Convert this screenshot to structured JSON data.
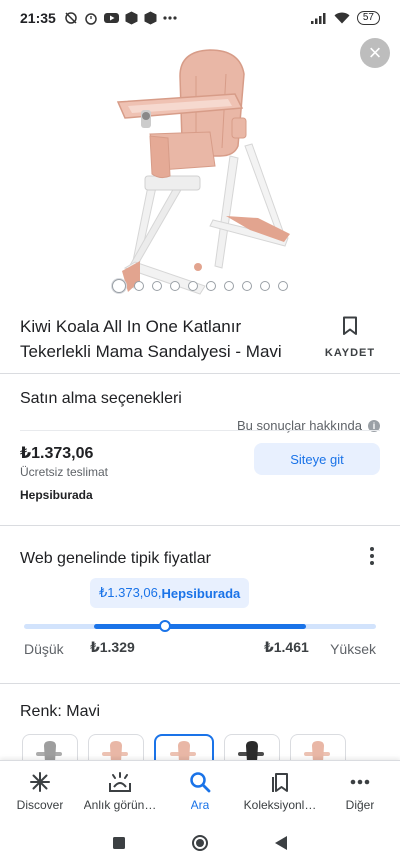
{
  "status_bar": {
    "time": "21:35",
    "battery": "57",
    "icons": [
      "alarm-off-icon",
      "alarm-icon",
      "youtube-icon",
      "package-icon",
      "package-icon",
      "more-dots-icon",
      "signal-icon",
      "wifi-icon",
      "battery-icon"
    ]
  },
  "hero": {
    "image_alt": "pink high chair",
    "image_count": 10,
    "active_index": 0,
    "close_icon": "close-icon"
  },
  "product": {
    "title": "Kiwi Koala All In One Katlanır Tekerlekli Mama Sandalyesi - Mavi",
    "save_label": "KAYDET"
  },
  "buying": {
    "heading": "Satın alma seçenekleri",
    "about_results": "Bu sonuçlar hakkında",
    "price": "₺1.373,06",
    "shipping": "Ücretsiz teslimat",
    "seller": "Hepsiburada",
    "visit_button": "Siteye git"
  },
  "price_range": {
    "heading": "Web genelinde tipik fiyatlar",
    "tooltip_price": "₺1.373,06, ",
    "tooltip_seller": "Hepsiburada",
    "low_label": "Düşük",
    "high_label": "Yüksek",
    "low_value": "₺1.329",
    "high_value": "₺1.461",
    "range_start_fraction": 0.2,
    "range_end_fraction": 0.8,
    "current_fraction": 0.4
  },
  "color": {
    "heading": "Renk: Mavi",
    "swatches": [
      {
        "color": "#9e9e9e",
        "selected": false
      },
      {
        "color": "#e9b7a6",
        "selected": false
      },
      {
        "color": "#e9b7a6",
        "selected": true
      },
      {
        "color": "#2b2b2b",
        "selected": false
      },
      {
        "color": "#e9b7a6",
        "selected": false
      }
    ]
  },
  "bottom_nav": [
    {
      "label": "Discover",
      "icon": "discover-icon",
      "active": false
    },
    {
      "label": "Anlık görün…",
      "icon": "snapshot-icon",
      "active": false
    },
    {
      "label": "Ara",
      "icon": "search-icon",
      "active": true
    },
    {
      "label": "Koleksiyonl…",
      "icon": "collections-icon",
      "active": false
    },
    {
      "label": "Diğer",
      "icon": "more-icon",
      "active": false
    }
  ],
  "colors": {
    "accent": "#1a73e8",
    "accent_light": "#e8f0fe",
    "product_pink": "#e9b7a6"
  }
}
